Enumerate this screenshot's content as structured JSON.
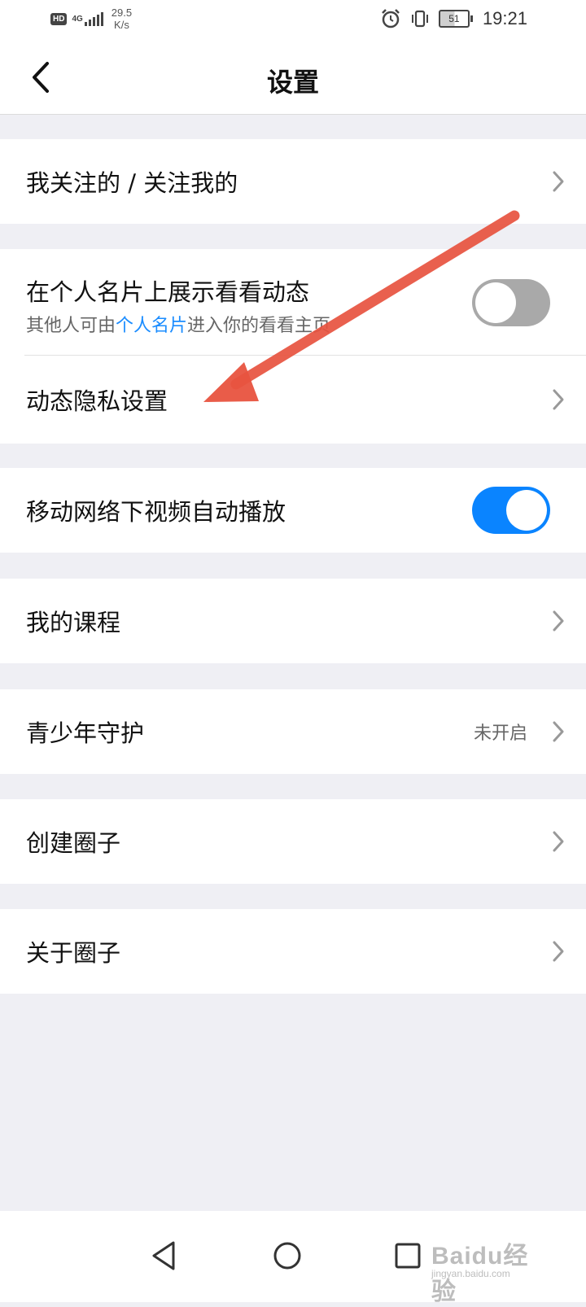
{
  "status_bar": {
    "hd": "HD",
    "network": "4G",
    "speed_value": "29.5",
    "speed_unit": "K/s",
    "battery": "51",
    "time": "19:21"
  },
  "header": {
    "title": "设置"
  },
  "groups": [
    {
      "rows": [
        {
          "label": "我关注的 / 关注我的",
          "type": "chevron"
        }
      ]
    },
    {
      "rows": [
        {
          "label": "在个人名片上展示看看动态",
          "sub_prefix": "其他人可由",
          "sub_link": "个人名片",
          "sub_suffix": "进入你的看看主页",
          "type": "toggle",
          "state": "off"
        },
        {
          "label": "动态隐私设置",
          "type": "chevron"
        }
      ]
    },
    {
      "rows": [
        {
          "label": "移动网络下视频自动播放",
          "type": "toggle",
          "state": "on"
        }
      ]
    },
    {
      "rows": [
        {
          "label": "我的课程",
          "type": "chevron"
        }
      ]
    },
    {
      "rows": [
        {
          "label": "青少年守护",
          "value": "未开启",
          "type": "chevron"
        }
      ]
    },
    {
      "rows": [
        {
          "label": "创建圈子",
          "type": "chevron"
        }
      ]
    },
    {
      "rows": [
        {
          "label": "关于圈子",
          "type": "chevron"
        }
      ]
    }
  ],
  "watermark": {
    "main": "Baidu经验",
    "sub": "jingyan.baidu.com"
  },
  "colors": {
    "accent": "#0a84ff",
    "link": "#1a8cff",
    "annotation_arrow": "#e8533f",
    "background": "#efeff4"
  }
}
